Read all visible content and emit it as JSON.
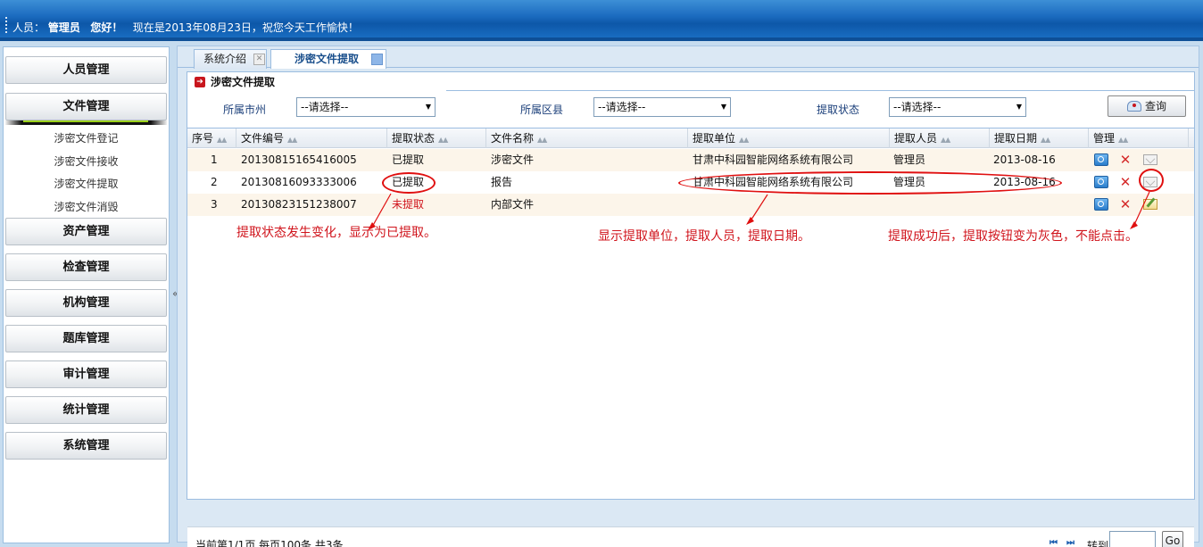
{
  "header": {
    "user_label": "人员：",
    "user_name": "管理员",
    "greeting": "您好！",
    "date_text": "现在是2013年08月23日，祝您今天工作愉快！"
  },
  "sidebar": {
    "menus": [
      {
        "label": "人员管理"
      },
      {
        "label": "文件管理"
      },
      {
        "label": "资产管理"
      },
      {
        "label": "检查管理"
      },
      {
        "label": "机构管理"
      },
      {
        "label": "题库管理"
      },
      {
        "label": "审计管理"
      },
      {
        "label": "统计管理"
      },
      {
        "label": "系统管理"
      }
    ],
    "sub_items": [
      {
        "label": "涉密文件登记"
      },
      {
        "label": "涉密文件接收"
      },
      {
        "label": "涉密文件提取"
      },
      {
        "label": "涉密文件消毁"
      }
    ],
    "collapse_glyph": "«"
  },
  "tabs": [
    {
      "label": "系统介绍"
    },
    {
      "label": "涉密文件提取"
    }
  ],
  "panel": {
    "title": "涉密文件提取"
  },
  "filters": {
    "city_label": "所属市州",
    "city_value": "--请选择--",
    "district_label": "所属区县",
    "district_value": "--请选择--",
    "status_label": "提取状态",
    "status_value": "--请选择--",
    "query_label": "查询"
  },
  "table": {
    "headers": [
      "序号",
      "文件编号",
      "提取状态",
      "文件名称",
      "提取单位",
      "提取人员",
      "提取日期",
      "管理"
    ],
    "rows": [
      {
        "index": "1",
        "number": "20130815165416005",
        "status": "已提取",
        "name": "涉密文件",
        "unit": "甘肃中科园智能网络系统有限公司",
        "person": "管理员",
        "date": "2013-08-16"
      },
      {
        "index": "2",
        "number": "20130816093333006",
        "status": "已提取",
        "name": "报告",
        "unit": "甘肃中科园智能网络系统有限公司",
        "person": "管理员",
        "date": "2013-08-16"
      },
      {
        "index": "3",
        "number": "20130823151238007",
        "status": "未提取",
        "name": "内部文件",
        "unit": "",
        "person": "",
        "date": ""
      }
    ]
  },
  "annotations": {
    "note1": "提取状态发生变化，显示为已提取。",
    "note2": "显示提取单位，提取人员，提取日期。",
    "note3": "提取成功后，提取按钮变为灰色，不能点击。"
  },
  "pager": {
    "info": "当前第1/1页  每页100条  共3条",
    "first": "⏮",
    "last": "⏭",
    "goto_label": "转到",
    "goto_value": "",
    "go_label": "Go"
  },
  "colors": {
    "accent": "#1c6cc0",
    "alert": "#d0141c"
  }
}
